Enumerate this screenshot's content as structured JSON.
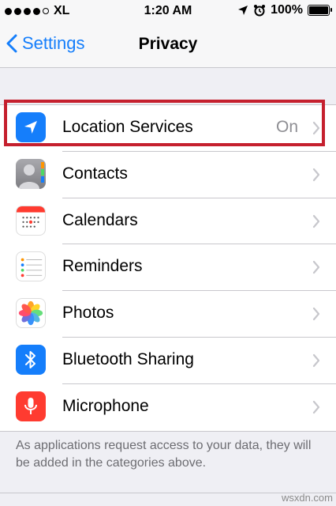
{
  "status_bar": {
    "carrier": "XL",
    "time": "1:20 AM",
    "battery": "100%",
    "battery_level": 1.0
  },
  "nav": {
    "back_label": "Settings",
    "title": "Privacy"
  },
  "rows": [
    {
      "label": "Location Services",
      "value": "On",
      "icon": "location-arrow-icon",
      "color": "#157efb"
    },
    {
      "label": "Contacts",
      "value": "",
      "icon": "contacts-icon",
      "color": "#9a9a9f"
    },
    {
      "label": "Calendars",
      "value": "",
      "icon": "calendar-icon",
      "color": "#ff3b30"
    },
    {
      "label": "Reminders",
      "value": "",
      "icon": "reminders-icon",
      "color": "#ffffff"
    },
    {
      "label": "Photos",
      "value": "",
      "icon": "photos-icon",
      "color": "#ffffff"
    },
    {
      "label": "Bluetooth Sharing",
      "value": "",
      "icon": "bluetooth-icon",
      "color": "#157efb"
    },
    {
      "label": "Microphone",
      "value": "",
      "icon": "microphone-icon",
      "color": "#ff3b30"
    }
  ],
  "footer": "As applications request access to your data, they will be added in the categories above.",
  "watermark": "wsxdn.com",
  "colors": {
    "accent": "#157efb",
    "highlight": "#c5202e",
    "background": "#efeff4"
  }
}
